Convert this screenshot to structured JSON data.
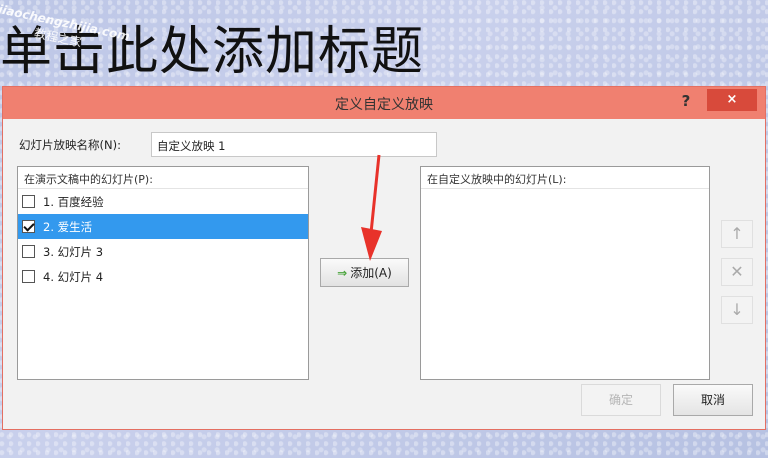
{
  "slide": {
    "title_placeholder": "单击此处添加标题",
    "watermark_url": "jiaochengzhijia.com",
    "watermark_name": "教程之家"
  },
  "dialog": {
    "title": "定义自定义放映",
    "help_label": "?",
    "close_label": "×",
    "name_label": "幻灯片放映名称(N):",
    "name_value": "自定义放映 1",
    "left_header": "在演示文稿中的幻灯片(P):",
    "right_header": "在自定义放映中的幻灯片(L):",
    "slides": [
      {
        "label": "1. 百度经验",
        "checked": false
      },
      {
        "label": "2. 爱生活",
        "checked": true
      },
      {
        "label": "3. 幻灯片 3",
        "checked": false
      },
      {
        "label": "4. 幻灯片 4",
        "checked": false
      }
    ],
    "add_button": "添加(A)",
    "add_icon": "⇒",
    "move_up": "↑",
    "remove": "✕",
    "move_down": "↓",
    "ok_button": "确定",
    "cancel_button": "取消"
  },
  "colors": {
    "titlebar": "#f08070",
    "close_button": "#d84a3b",
    "selection": "#3399ee",
    "annotation_arrow": "#e8322a"
  }
}
